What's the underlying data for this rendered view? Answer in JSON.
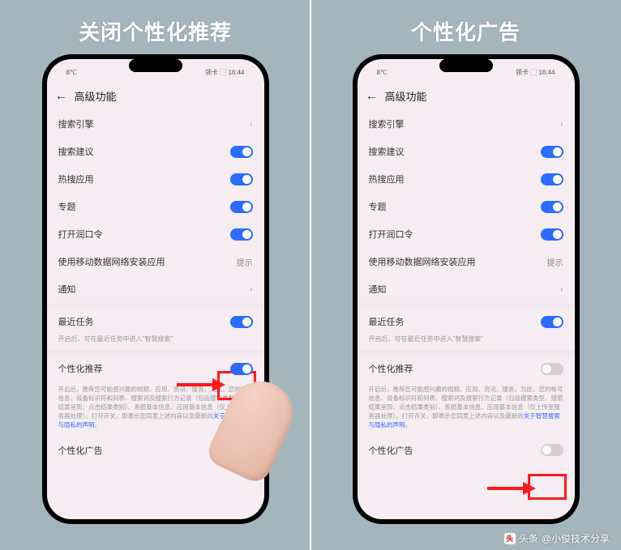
{
  "captions": {
    "left": "关闭个性化推荐",
    "right": "个性化广告"
  },
  "statusbar": {
    "left": "8℃",
    "right": "领卡 ⬚ 16:44"
  },
  "header": {
    "title": "高级功能"
  },
  "rows": {
    "search_engine": "搜索引擎",
    "search_suggest": "搜索建议",
    "hot_apps": "热搜应用",
    "topics": "专题",
    "wake_word": "打开润口令",
    "install_mobile": "使用移动数据网络安装应用",
    "install_hint": "提示",
    "notify": "通知",
    "recent_task": "最近任务",
    "recent_sub": "开启后，可在最近任务中进入\"智慧搜索\"",
    "personal_rec": "个性化推荐",
    "personal_ads": "个性化广告"
  },
  "desc": {
    "p1": "开启后，推荐您可能感兴趣的视频、应用、资讯、服务，为此，您的帐号信息、设备标识符和列表、搜索词及搜索行为记录（包括搜索类型、搜索结果呈现、点击结果类别）、系统基本信息、应用基本信息（仅上传至服务器处理）。打开开关，即表示您同意上述内容以及最新的",
    "link": "关于智慧搜索与隐私的声明",
    "after": "。"
  },
  "watermark": {
    "prefix": "头条",
    "author": "@小俊技术分享"
  }
}
